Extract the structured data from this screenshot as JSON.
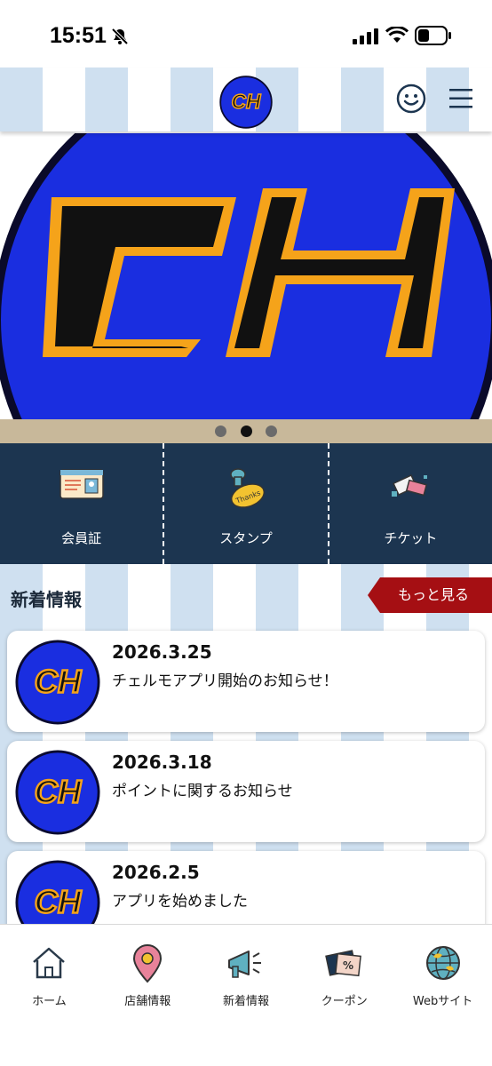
{
  "status_bar": {
    "time": "15:51",
    "icons": [
      "bell-off-icon",
      "signal-icon",
      "wifi-icon",
      "battery-icon"
    ]
  },
  "header": {
    "logo_text": "CH",
    "icons": [
      "face-icon",
      "menu-icon"
    ]
  },
  "hero": {
    "logo_text": "CH",
    "carousel_count": 3,
    "carousel_active": 1
  },
  "quick_menu": [
    {
      "label": "会員証",
      "icon": "member-card-icon"
    },
    {
      "label": "スタンプ",
      "icon": "stamp-icon"
    },
    {
      "label": "チケット",
      "icon": "ticket-icon"
    }
  ],
  "news": {
    "title": "新着情報",
    "more_label": "もっと見る",
    "items": [
      {
        "date": "2026.3.25",
        "text": "チェルモアプリ開始のお知らせ！",
        "logo_text": "CH"
      },
      {
        "date": "2026.3.18",
        "text": "ポイントに関するお知らせ",
        "logo_text": "CH"
      },
      {
        "date": "2026.2.5",
        "text": "アプリを始めました",
        "logo_text": "CH"
      }
    ]
  },
  "tabbar": [
    {
      "label": "ホーム",
      "icon": "home-icon"
    },
    {
      "label": "店舗情報",
      "icon": "map-pin-icon"
    },
    {
      "label": "新着情報",
      "icon": "megaphone-icon"
    },
    {
      "label": "クーポン",
      "icon": "coupon-icon"
    },
    {
      "label": "Webサイト",
      "icon": "globe-icon"
    }
  ],
  "colors": {
    "navy": "#1c3550",
    "stripe_blue": "#cfe0f0",
    "more_red": "#a50f13",
    "logo_blue": "#1a2ee0",
    "logo_orange": "#f5a31a",
    "dots_bar": "#c8b89a"
  }
}
